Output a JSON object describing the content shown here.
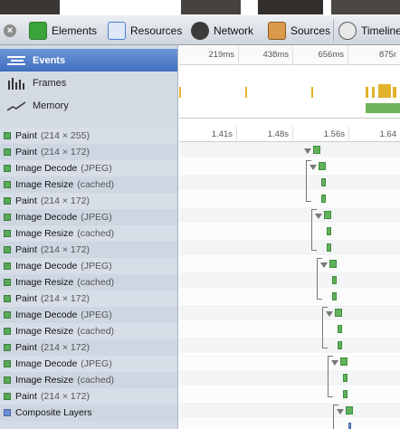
{
  "toolbar": {
    "tabs": [
      {
        "label": "Elements",
        "icon": "elements-icon",
        "color": "#3aa33a"
      },
      {
        "label": "Resources",
        "icon": "resources-icon",
        "color": "#4a7fd0"
      },
      {
        "label": "Network",
        "icon": "network-icon",
        "color": "#3b3b3b"
      },
      {
        "label": "Sources",
        "icon": "sources-icon",
        "color": "#b06a2a"
      },
      {
        "label": "Timeline",
        "icon": "timeline-icon",
        "color": "#5c5c5c"
      }
    ]
  },
  "sidebar": {
    "nav": [
      {
        "label": "Events",
        "icon": "events-icon",
        "selected": true
      },
      {
        "label": "Frames",
        "icon": "frames-icon",
        "selected": false
      },
      {
        "label": "Memory",
        "icon": "memory-icon",
        "selected": false
      }
    ],
    "records": [
      {
        "name": "Paint",
        "detail": "(214 × 255)"
      },
      {
        "name": "Paint",
        "detail": "(214 × 172)"
      },
      {
        "name": "Image Decode",
        "detail": "(JPEG)"
      },
      {
        "name": "Image Resize",
        "detail": "(cached)"
      },
      {
        "name": "Paint",
        "detail": "(214 × 172)"
      },
      {
        "name": "Image Decode",
        "detail": "(JPEG)"
      },
      {
        "name": "Image Resize",
        "detail": "(cached)"
      },
      {
        "name": "Paint",
        "detail": "(214 × 172)"
      },
      {
        "name": "Image Decode",
        "detail": "(JPEG)"
      },
      {
        "name": "Image Resize",
        "detail": "(cached)"
      },
      {
        "name": "Paint",
        "detail": "(214 × 172)"
      },
      {
        "name": "Image Decode",
        "detail": "(JPEG)"
      },
      {
        "name": "Image Resize",
        "detail": "(cached)"
      },
      {
        "name": "Paint",
        "detail": "(214 × 172)"
      },
      {
        "name": "Image Decode",
        "detail": "(JPEG)"
      },
      {
        "name": "Image Resize",
        "detail": "(cached)"
      },
      {
        "name": "Paint",
        "detail": "(214 × 172)"
      },
      {
        "name": "Composite Layers",
        "detail": ""
      }
    ]
  },
  "timeline": {
    "overview_ticks": [
      "219ms",
      "438ms",
      "656ms",
      "875r"
    ],
    "detail_ticks": [
      "1.41s",
      "1.48s",
      "1.56s",
      "1.64"
    ]
  }
}
